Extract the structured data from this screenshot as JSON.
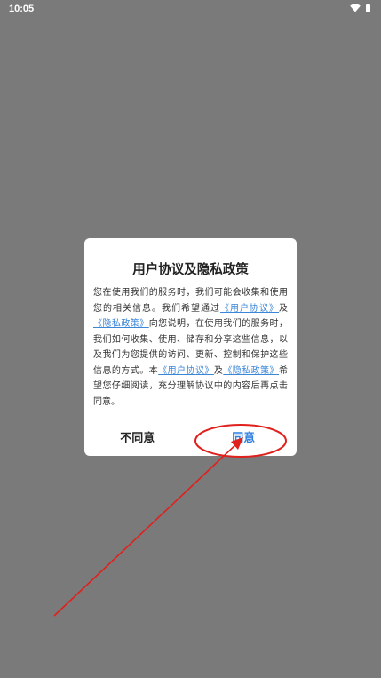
{
  "status_bar": {
    "time": "10:05"
  },
  "dialog": {
    "title": "用户协议及隐私政策",
    "body": {
      "text1": "您在使用我们的服务时，我们可能会收集和使用您的相关信息。我们希望通过",
      "link_user_agreement_1": "《用户协议》",
      "text2": "及",
      "link_privacy_1": "《隐私政策》",
      "text3": "向您说明，在使用我们的服务时，我们如何收集、使用、储存和分享这些信息，以及我们为您提供的访问、更新、控制和保护这些信息的方式。本",
      "link_user_agreement_2": "《用户协议》",
      "text4": "及",
      "link_privacy_2": "《隐私政策》",
      "text5": "希望您仔细阅读，充分理解协议中的内容后再点击同意。"
    },
    "disagree_label": "不同意",
    "agree_label": "同意"
  },
  "colors": {
    "overlay": "#7a7a7a",
    "link": "#3c86d8",
    "agree": "#2f7fe0",
    "annotation": "#e0201c"
  },
  "icons": [
    "wifi-icon",
    "battery-icon"
  ]
}
